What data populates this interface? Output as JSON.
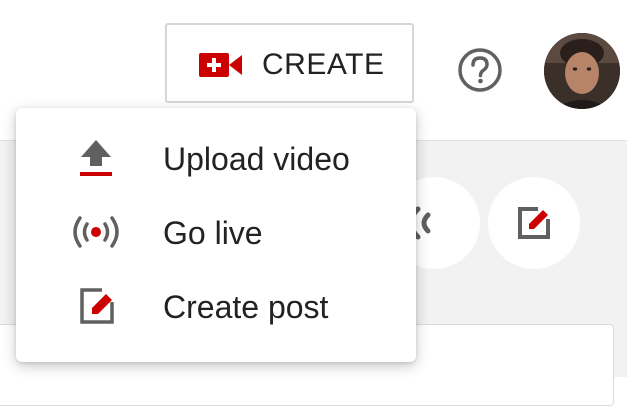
{
  "header": {
    "create_label": "CREATE",
    "create_icon": "video-camera-plus-icon",
    "help_icon": "help-circle-icon",
    "avatar_icon": "user-avatar"
  },
  "menu": {
    "items": [
      {
        "label": "Upload video",
        "icon": "upload-icon"
      },
      {
        "label": "Go live",
        "icon": "live-broadcast-icon"
      },
      {
        "label": "Create post",
        "icon": "create-post-icon"
      }
    ]
  },
  "colors": {
    "accent": "#cc0000",
    "icon_gray": "#606060",
    "text": "#212121",
    "page_bg": "#f2f2f2"
  }
}
